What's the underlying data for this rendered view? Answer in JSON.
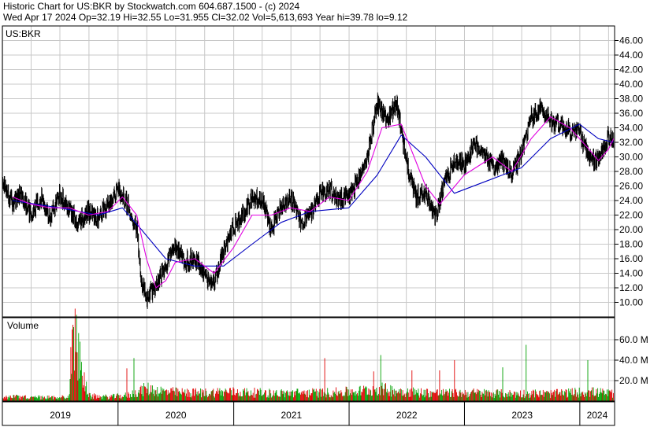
{
  "header": {
    "line1": "Historic Chart for US:BKR by Stockwatch.com 604.687.1500 - (c) 2024",
    "line2": "Wed Apr 17 2024   Op=32.19  Hi=32.55  Lo=31.955  Cl=32.02  Vol=5,613,693  Year hi=39.78  lo=9.12"
  },
  "colors": {
    "price": "#000000",
    "ma_short": "#e000e0",
    "ma_long": "#0000c0",
    "vol_up": "#00a000",
    "vol_down": "#e00000",
    "grid": "#c8c8c8"
  },
  "chart_data": [
    {
      "type": "line",
      "symbol_label": "US:BKR",
      "ylim": [
        8,
        48
      ],
      "y_ticks": [
        "10.00",
        "12.00",
        "14.00",
        "16.00",
        "18.00",
        "20.00",
        "22.00",
        "24.00",
        "26.00",
        "28.00",
        "30.00",
        "32.00",
        "34.00",
        "36.00",
        "38.00",
        "40.00",
        "42.00",
        "44.00",
        "46.00"
      ],
      "x_ticks": [
        "2019",
        "2020",
        "2021",
        "2022",
        "2023",
        "2024"
      ],
      "grid": true,
      "series": [
        {
          "style": "daily high-low bars",
          "values": [
            [
              "2018-12-31",
              26.5
            ],
            [
              "2019-01-31",
              23.5
            ],
            [
              "2019-02-28",
              25.0
            ],
            [
              "2019-03-31",
              22.0
            ],
            [
              "2019-04-30",
              24.5
            ],
            [
              "2019-05-31",
              21.5
            ],
            [
              "2019-06-30",
              25.0
            ],
            [
              "2019-07-31",
              22.5
            ],
            [
              "2019-08-31",
              21.0
            ],
            [
              "2019-09-30",
              22.5
            ],
            [
              "2019-10-31",
              21.5
            ],
            [
              "2019-11-30",
              23.5
            ],
            [
              "2019-12-31",
              25.5
            ],
            [
              "2020-01-31",
              23.5
            ],
            [
              "2020-02-29",
              20.0
            ],
            [
              "2020-03-15",
              13.0
            ],
            [
              "2020-03-31",
              10.5
            ],
            [
              "2020-04-30",
              12.5
            ],
            [
              "2020-05-31",
              15.0
            ],
            [
              "2020-06-30",
              17.5
            ],
            [
              "2020-07-31",
              15.5
            ],
            [
              "2020-08-31",
              16.0
            ],
            [
              "2020-09-30",
              13.5
            ],
            [
              "2020-10-31",
              13.0
            ],
            [
              "2020-11-30",
              17.0
            ],
            [
              "2020-12-31",
              20.5
            ],
            [
              "2021-01-31",
              22.0
            ],
            [
              "2021-02-28",
              24.5
            ],
            [
              "2021-03-31",
              24.0
            ],
            [
              "2021-04-30",
              20.0
            ],
            [
              "2021-05-31",
              23.5
            ],
            [
              "2021-06-30",
              24.5
            ],
            [
              "2021-07-31",
              21.0
            ],
            [
              "2021-08-31",
              22.0
            ],
            [
              "2021-09-30",
              25.0
            ],
            [
              "2021-10-31",
              25.5
            ],
            [
              "2021-11-30",
              24.0
            ],
            [
              "2021-12-31",
              24.5
            ],
            [
              "2022-01-31",
              27.0
            ],
            [
              "2022-02-28",
              30.0
            ],
            [
              "2022-03-31",
              37.5
            ],
            [
              "2022-04-30",
              35.0
            ],
            [
              "2022-05-31",
              37.5
            ],
            [
              "2022-06-30",
              29.5
            ],
            [
              "2022-07-31",
              24.5
            ],
            [
              "2022-08-31",
              25.0
            ],
            [
              "2022-09-30",
              21.5
            ],
            [
              "2022-10-31",
              26.5
            ],
            [
              "2022-11-30",
              29.5
            ],
            [
              "2022-12-31",
              29.0
            ],
            [
              "2023-01-31",
              31.5
            ],
            [
              "2023-02-28",
              31.0
            ],
            [
              "2023-03-31",
              28.5
            ],
            [
              "2023-04-30",
              29.5
            ],
            [
              "2023-05-31",
              27.5
            ],
            [
              "2023-06-30",
              30.5
            ],
            [
              "2023-07-31",
              35.5
            ],
            [
              "2023-08-31",
              36.5
            ],
            [
              "2023-09-30",
              35.0
            ],
            [
              "2023-10-31",
              34.5
            ],
            [
              "2023-11-30",
              33.5
            ],
            [
              "2023-12-31",
              33.5
            ],
            [
              "2024-01-31",
              29.5
            ],
            [
              "2024-02-29",
              29.5
            ],
            [
              "2024-03-31",
              33.0
            ],
            [
              "2024-04-17",
              32.0
            ]
          ]
        },
        {
          "style": "short moving average (magenta)",
          "values": [
            [
              "2019-02-01",
              24.5
            ],
            [
              "2019-03-31",
              23.5
            ],
            [
              "2019-05-31",
              23.0
            ],
            [
              "2019-07-31",
              23.0
            ],
            [
              "2019-09-30",
              22.0
            ],
            [
              "2019-11-30",
              22.5
            ],
            [
              "2020-01-15",
              24.5
            ],
            [
              "2020-02-29",
              22.0
            ],
            [
              "2020-03-31",
              16.0
            ],
            [
              "2020-04-30",
              12.0
            ],
            [
              "2020-05-31",
              13.0
            ],
            [
              "2020-06-30",
              15.5
            ],
            [
              "2020-08-31",
              16.0
            ],
            [
              "2020-10-31",
              14.0
            ],
            [
              "2020-12-31",
              17.5
            ],
            [
              "2021-02-28",
              22.0
            ],
            [
              "2021-04-30",
              22.0
            ],
            [
              "2021-06-30",
              23.0
            ],
            [
              "2021-08-31",
              22.5
            ],
            [
              "2021-10-31",
              24.5
            ],
            [
              "2021-12-31",
              24.0
            ],
            [
              "2022-02-28",
              28.0
            ],
            [
              "2022-04-15",
              34.0
            ],
            [
              "2022-06-15",
              34.5
            ],
            [
              "2022-08-31",
              26.0
            ],
            [
              "2022-10-15",
              23.5
            ],
            [
              "2022-12-31",
              27.5
            ],
            [
              "2023-03-31",
              30.0
            ],
            [
              "2023-05-31",
              28.0
            ],
            [
              "2023-07-31",
              32.5
            ],
            [
              "2023-09-30",
              35.5
            ],
            [
              "2023-11-30",
              34.0
            ],
            [
              "2024-01-31",
              31.0
            ],
            [
              "2024-02-29",
              29.5
            ],
            [
              "2024-03-31",
              31.0
            ],
            [
              "2024-04-17",
              32.5
            ]
          ]
        },
        {
          "style": "long moving average (blue)",
          "values": [
            [
              "2019-02-01",
              24.0
            ],
            [
              "2019-06-30",
              23.0
            ],
            [
              "2019-10-31",
              22.0
            ],
            [
              "2020-01-15",
              23.0
            ],
            [
              "2020-03-15",
              20.0
            ],
            [
              "2020-05-31",
              16.0
            ],
            [
              "2020-08-31",
              15.0
            ],
            [
              "2020-11-30",
              15.0
            ],
            [
              "2021-02-28",
              18.0
            ],
            [
              "2021-05-31",
              21.0
            ],
            [
              "2021-08-31",
              22.5
            ],
            [
              "2021-12-31",
              23.0
            ],
            [
              "2022-03-31",
              27.5
            ],
            [
              "2022-06-15",
              33.0
            ],
            [
              "2022-08-31",
              30.0
            ],
            [
              "2022-11-30",
              25.0
            ],
            [
              "2023-03-31",
              27.0
            ],
            [
              "2023-06-30",
              28.5
            ],
            [
              "2023-09-30",
              32.5
            ],
            [
              "2023-12-31",
              34.5
            ],
            [
              "2024-02-29",
              32.5
            ],
            [
              "2024-04-17",
              32.0
            ]
          ]
        }
      ]
    },
    {
      "type": "bar",
      "title": "Volume",
      "ylim": [
        0,
        80
      ],
      "y_ticks": [
        "20.0 M",
        "40.0 M",
        "60.0 M"
      ],
      "grid": true,
      "series": [
        {
          "name": "Volume",
          "values": [
            [
              "2019-01-31",
              4.0
            ],
            [
              "2019-03-31",
              3.5
            ],
            [
              "2019-05-31",
              3.5
            ],
            [
              "2019-07-31",
              4.0
            ],
            [
              "2019-08-10",
              70.0
            ],
            [
              "2019-09-30",
              5.0
            ],
            [
              "2019-11-30",
              4.0
            ],
            [
              "2020-01-31",
              5.5
            ],
            [
              "2020-03-31",
              12.0
            ],
            [
              "2020-05-31",
              9.0
            ],
            [
              "2020-07-31",
              8.0
            ],
            [
              "2020-09-30",
              8.0
            ],
            [
              "2020-11-30",
              9.0
            ],
            [
              "2021-01-31",
              8.5
            ],
            [
              "2021-03-31",
              8.0
            ],
            [
              "2021-05-31",
              7.5
            ],
            [
              "2021-07-31",
              8.0
            ],
            [
              "2021-09-30",
              8.0
            ],
            [
              "2021-11-30",
              8.5
            ],
            [
              "2022-01-31",
              9.5
            ],
            [
              "2022-03-31",
              12.0
            ],
            [
              "2022-05-31",
              10.0
            ],
            [
              "2022-07-31",
              8.5
            ],
            [
              "2022-09-30",
              8.0
            ],
            [
              "2022-11-30",
              7.5
            ],
            [
              "2023-01-31",
              8.0
            ],
            [
              "2023-03-31",
              7.5
            ],
            [
              "2023-05-31",
              7.0
            ],
            [
              "2023-07-31",
              7.5
            ],
            [
              "2023-09-30",
              7.0
            ],
            [
              "2023-11-30",
              8.0
            ],
            [
              "2024-01-31",
              9.0
            ],
            [
              "2024-03-31",
              7.5
            ]
          ]
        }
      ]
    }
  ]
}
